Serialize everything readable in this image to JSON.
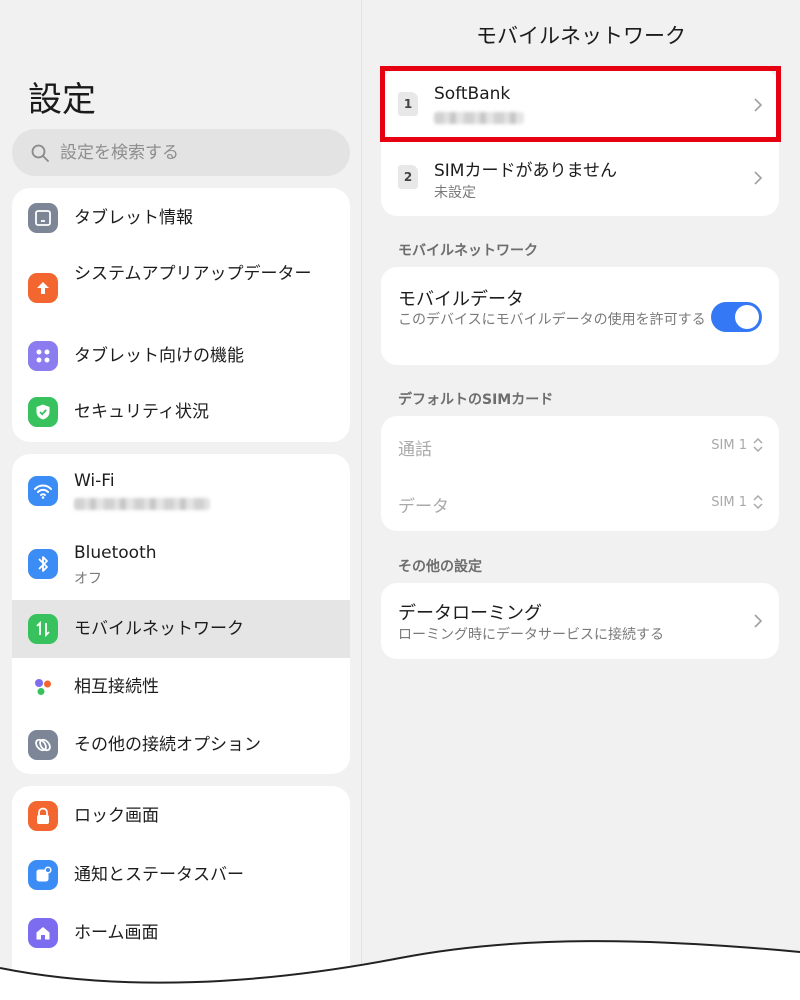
{
  "left": {
    "title": "設定",
    "search": {
      "placeholder": "設定を検索する"
    },
    "group1": [
      {
        "label": "タブレット情報",
        "icon": "tablet-info-icon",
        "color": "#7d8697"
      },
      {
        "label": "システムアプリアップデーター",
        "icon": "system-update-icon",
        "color": "#f4662f"
      },
      {
        "label": "タブレット向けの機能",
        "icon": "tablet-features-icon",
        "color": "#8b7cf0"
      },
      {
        "label": "セキュリティ状況",
        "icon": "security-shield-icon",
        "color": "#37c25e"
      }
    ],
    "group2": [
      {
        "label": "Wi-Fi",
        "icon": "wifi-icon",
        "color": "#3c8cf5"
      },
      {
        "label": "Bluetooth",
        "sub": "オフ",
        "icon": "bluetooth-icon",
        "color": "#3c8cf5"
      },
      {
        "label": "モバイルネットワーク",
        "icon": "mobile-network-icon",
        "color": "#37c25e",
        "selected": true
      },
      {
        "label": "相互接続性",
        "icon": "interconnect-icon",
        "color": "#ffffff"
      },
      {
        "label": "その他の接続オプション",
        "icon": "link-icon",
        "color": "#7d8697"
      }
    ],
    "group3": [
      {
        "label": "ロック画面",
        "icon": "lock-icon",
        "color": "#f4662f"
      },
      {
        "label": "通知とステータスバー",
        "icon": "notification-icon",
        "color": "#3c8cf5"
      },
      {
        "label": "ホーム画面",
        "icon": "home-icon",
        "color": "#7b6cf0"
      }
    ]
  },
  "right": {
    "title": "モバイルネットワーク",
    "sims": [
      {
        "slot": "1",
        "name": "SoftBank"
      },
      {
        "slot": "2",
        "name": "SIMカードがありません",
        "status": "未設定"
      }
    ],
    "section_mobile": "モバイルネットワーク",
    "mobile_data": {
      "title": "モバイルデータ",
      "desc": "このデバイスにモバイルデータの使用を許可する",
      "enabled": true
    },
    "section_default_sim": "デフォルトのSIMカード",
    "default_sim": [
      {
        "label": "通話",
        "value": "SIM 1"
      },
      {
        "label": "データ",
        "value": "SIM 1"
      }
    ],
    "section_other": "その他の設定",
    "roaming": {
      "title": "データローミング",
      "desc": "ローミング時にデータサービスに接続する"
    }
  },
  "colors": {
    "accent": "#3478f6",
    "highlight": "#e60012"
  }
}
